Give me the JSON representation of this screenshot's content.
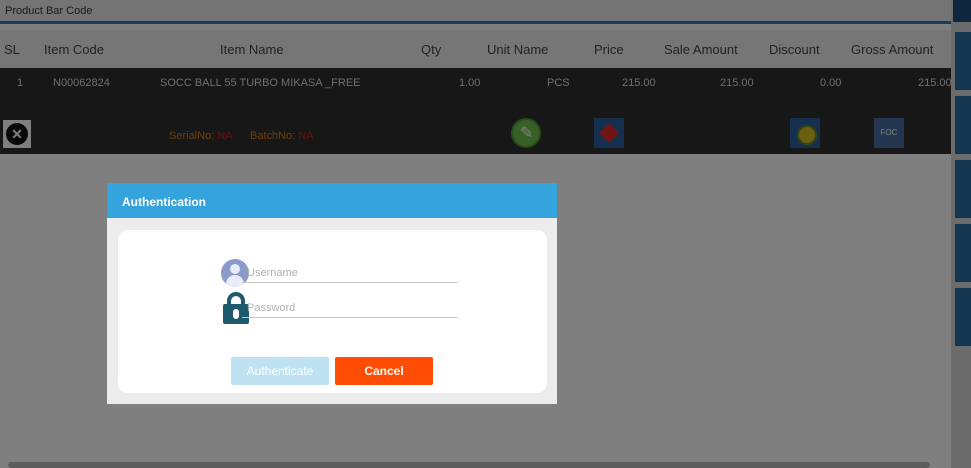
{
  "toolbar": {
    "label": "Product Bar Code"
  },
  "table": {
    "headers": [
      "SL",
      "Item Code",
      "Item Name",
      "Qty",
      "Unit Name",
      "Price",
      "Sale Amount",
      "Discount",
      "Gross Amount"
    ],
    "row": {
      "sl": "1",
      "item_code": "N00062824",
      "item_name": "SOCC BALL 55 TURBO MIKASA _FREE",
      "qty": "1.00",
      "unit_name": "PCS",
      "price": "215.00",
      "sale_amount": "215.00",
      "discount": "0.00",
      "gross_amount": "215.00",
      "serial_label": "SerialNo:",
      "serial_value": "NA",
      "batch_label": "BatchNo:",
      "batch_value": "NA",
      "foc_label": "FOC"
    }
  },
  "dialog": {
    "title": "Authentication",
    "username_placeholder": "Username",
    "password_placeholder": "Password",
    "authenticate_label": "Authenticate",
    "cancel_label": "Cancel"
  },
  "colors": {
    "dialog_header": "#35a3dc",
    "cancel_button": "#ff4d06",
    "authenticate_button_disabled": "#bfe2f2",
    "row_background": "#2e2e2e",
    "accent_blue": "#2b7fb8"
  }
}
